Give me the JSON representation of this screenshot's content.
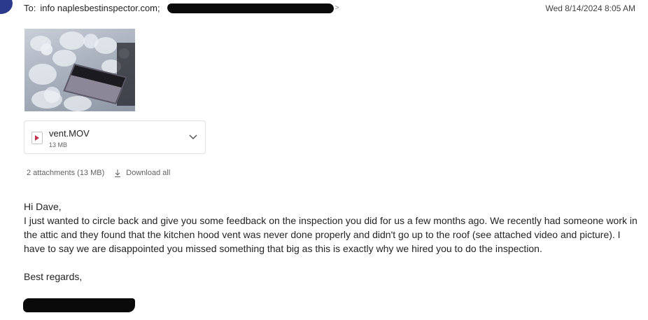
{
  "header": {
    "to_label": "To:",
    "to_address": "info naplesbestinspector.com;",
    "timestamp": "Wed 8/14/2024 8:05 AM"
  },
  "attachments": {
    "file_name": "vent.MOV",
    "file_size": "13 MB",
    "summary": "2 attachments (13 MB)",
    "download_all_label": "Download all"
  },
  "message": {
    "greeting": "Hi Dave,",
    "paragraph": "I just wanted to circle back and give you some feedback on the inspection you did for us a few months ago. We recently had someone work in the attic and they found that the kitchen hood vent was never done properly and didn't go up to the roof (see attached video and picture). I have to say we are disappointed you missed something that big as this is exactly why we hired you to do the inspection.",
    "signoff": "Best regards,"
  },
  "colors": {
    "text": "#242424",
    "muted": "#616161",
    "video_icon_accent": "#c4314b",
    "redaction": "#0a0a0a"
  }
}
